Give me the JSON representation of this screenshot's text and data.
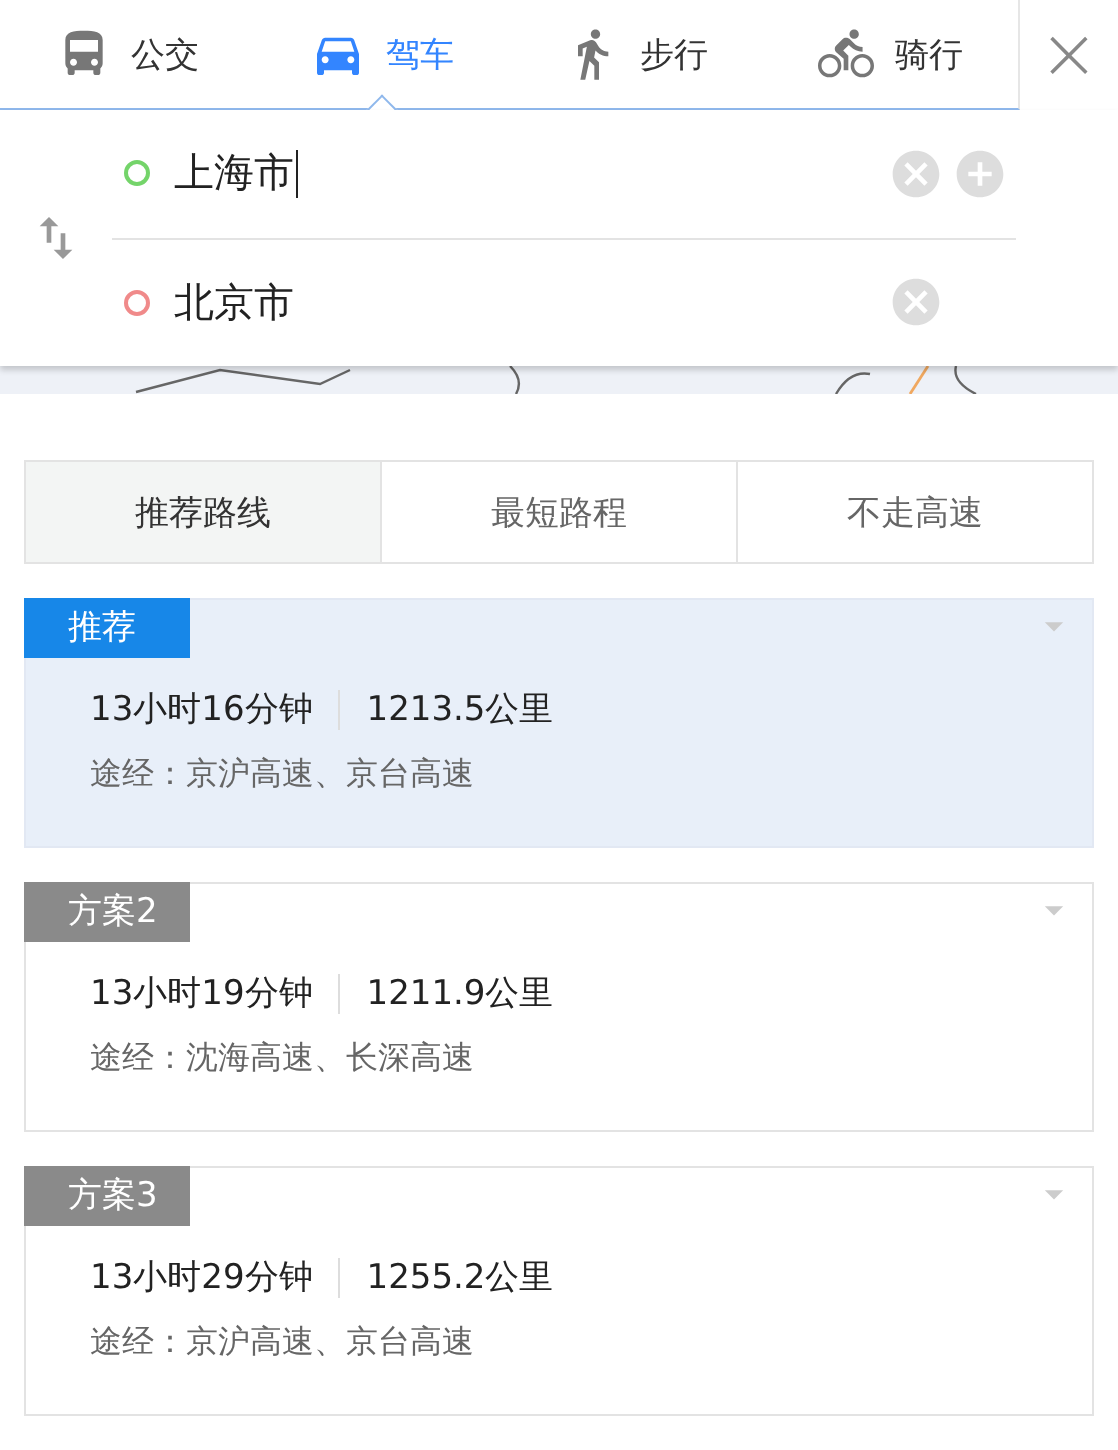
{
  "modes": [
    {
      "kind": "bus",
      "label": "公交",
      "selected": false
    },
    {
      "kind": "car",
      "label": "驾车",
      "selected": true
    },
    {
      "kind": "walk",
      "label": "步行",
      "selected": false
    },
    {
      "kind": "bike",
      "label": "骑行",
      "selected": false
    }
  ],
  "close": "×",
  "stops": [
    {
      "value": "上海市",
      "color": "#74d46a",
      "focused": true,
      "addable": true
    },
    {
      "value": "北京市",
      "color": "#f08a8a",
      "focused": false,
      "addable": false
    }
  ],
  "preferences": [
    {
      "label": "推荐路线",
      "selected": true
    },
    {
      "label": "最短路程",
      "selected": false
    },
    {
      "label": "不走高速",
      "selected": false
    }
  ],
  "routes": [
    {
      "badge": "推荐",
      "duration": "13小时16分钟",
      "distance": "1213.5公里",
      "via": "途经：京沪高速、京台高速",
      "selected": true
    },
    {
      "badge": "方案2",
      "duration": "13小时19分钟",
      "distance": "1211.9公里",
      "via": "途经：沈海高速、长深高速",
      "selected": false
    },
    {
      "badge": "方案3",
      "duration": "13小时29分钟",
      "distance": "1255.2公里",
      "via": "途经：京沪高速、京台高速",
      "selected": false
    }
  ]
}
